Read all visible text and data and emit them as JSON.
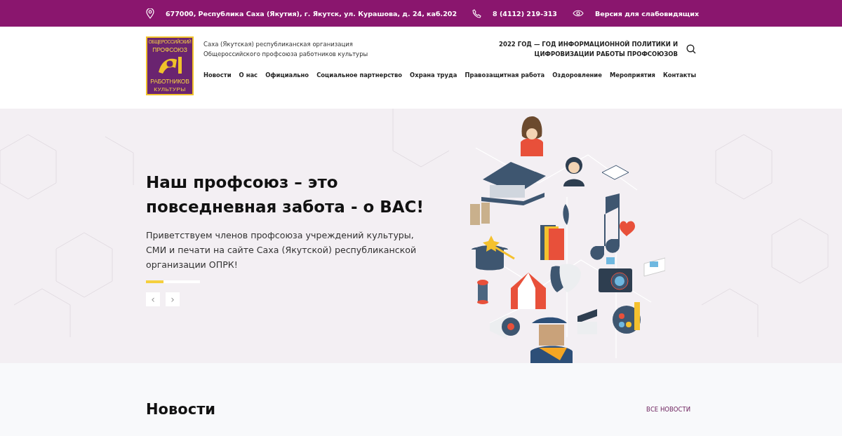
{
  "top_bar": {
    "address": "677000, Республика Саха (Якутия), г. Якутск, ул. Курашова, д. 24, каб.202",
    "phone": "8 (4112) 219-313",
    "accessibility": "Версия для слабовидящих"
  },
  "header": {
    "logo_lines": [
      "ОБЩЕРОССИЙСКИЙ",
      "ПРОФСОЮЗ",
      "РАБОТНИКОВ",
      "КУЛЬТУРЫ"
    ],
    "org_name": [
      "Саха (Якутская) республиканская организация",
      "Общероссийского профсоюза работников культуры"
    ],
    "announcement": [
      "2022 ГОД — ГОД ИНФОРМАЦИОННОЙ ПОЛИТИКИ И",
      "ЦИФРОВИЗАЦИИ РАБОТЫ ПРОФСОЮЗОВ"
    ],
    "nav": [
      "Новости",
      "О нас",
      "Официально",
      "Социальное партнерство",
      "Охрана труда",
      "Правозащитная работа",
      "Оздоровление",
      "Мероприятия",
      "Контакты"
    ]
  },
  "hero": {
    "title": "Наш профсоюз – это повседневная забота - о ВАС!",
    "text": "Приветствуем членов профсоюза учреждений культуры, СМИ и печати на сайте Саха (Якутской) республиканской организации ОПРК!",
    "slider_progress": {
      "level": 0.33
    },
    "prev_arrow": "‹",
    "next_arrow": "›"
  },
  "news": {
    "title": "Новости",
    "all_link": "ВСЕ НОВОСТИ"
  }
}
